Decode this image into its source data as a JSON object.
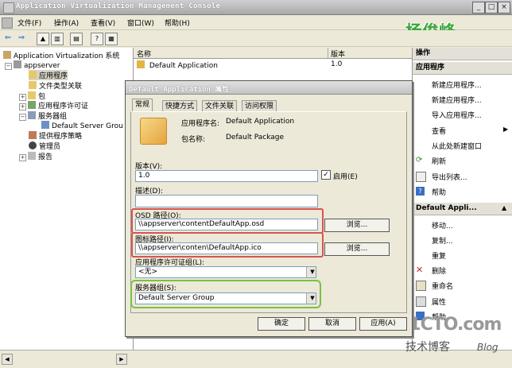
{
  "window": {
    "title": "Application Virtualization Management Console"
  },
  "menu": [
    "文件(F)",
    "操作(A)",
    "查看(V)",
    "窗口(W)",
    "帮助(H)"
  ],
  "watermark": {
    "name": "杨俊峰",
    "site": "51CTO.com",
    "sub": "技术博客",
    "blog": "Blog"
  },
  "tree": {
    "root": "Application Virtualization 系统",
    "server": "appserver",
    "items": [
      "应用程序",
      "文件类型关联",
      "包",
      "应用程序许可证",
      "服务器组",
      "Default Server Grou",
      "提供程序策略",
      "管理员",
      "报告"
    ]
  },
  "list": {
    "headers": [
      "名称",
      "版本"
    ],
    "rows": [
      {
        "name": "Default Application",
        "version": "1.0"
      }
    ]
  },
  "actions": {
    "header1": "操作",
    "header2": "应用程序",
    "group1": [
      "新建应用程序...",
      "新建应用程序...",
      "导入应用程序...",
      "查看",
      "从此处新建窗口",
      "刷新",
      "导出列表...",
      "帮助"
    ],
    "header3": "Default Appli...",
    "group2": [
      "移动...",
      "复制...",
      "重复",
      "删除",
      "重命名",
      "属性",
      "帮助"
    ]
  },
  "dialog": {
    "title": "Default Application 属性",
    "tabs": [
      "常规",
      "快捷方式",
      "文件关联",
      "访问权限"
    ],
    "app_name_label": "应用程序名:",
    "app_name": "Default Application",
    "package_label": "包名称:",
    "package": "Default Package",
    "version_label": "版本(V):",
    "version": "1.0",
    "enabled_label": "启用(E)",
    "enabled": true,
    "desc_label": "描述(D):",
    "desc": "",
    "osd_label": "OSD 路径(O):",
    "osd": "\\\\appserver\\contentDefaultApp.osd",
    "icon_label": "图标路径(I):",
    "icon": "\\\\appserver\\conten\\DefaultApp.ico",
    "browse": "浏览...",
    "license_label": "应用程序许可证组(L):",
    "license": "<无>",
    "group_label": "服务器组(S):",
    "group": "Default Server Group",
    "ok": "确定",
    "cancel": "取消",
    "apply": "应用(A)"
  }
}
